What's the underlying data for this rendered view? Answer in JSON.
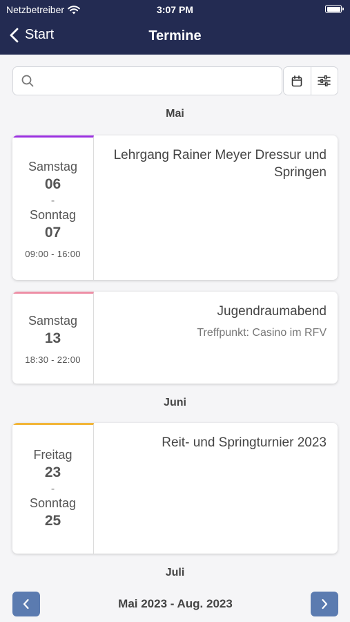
{
  "status_bar": {
    "carrier": "Netzbetreiber",
    "time": "3:07 PM"
  },
  "nav": {
    "back_label": "Start",
    "title": "Termine"
  },
  "search": {
    "placeholder": "",
    "value": ""
  },
  "toolbar": {
    "calendar_icon": "calendar-icon",
    "filter_icon": "sliders-icon"
  },
  "months": [
    "Mai",
    "Juni",
    "Juli"
  ],
  "events": [
    {
      "color": "#9b30e0",
      "start_day": "Samstag",
      "start_date": "06",
      "separator": "-",
      "end_day": "Sonntag",
      "end_date": "07",
      "time": "09:00 - 16:00",
      "title": "Lehrgang Rainer Meyer Dressur und Springen",
      "subtitle": ""
    },
    {
      "color": "#ee8fa6",
      "start_day": "Samstag",
      "start_date": "13",
      "time": "18:30 - 22:00",
      "title": "Jugendraumabend",
      "subtitle": "Treffpunkt: Casino im RFV"
    },
    {
      "color": "#f2b63a",
      "start_day": "Freitag",
      "start_date": "23",
      "separator": "-",
      "end_day": "Sonntag",
      "end_date": "25",
      "time": "",
      "title": "Reit- und Springturnier 2023",
      "subtitle": ""
    }
  ],
  "pager": {
    "range_label": "Mai 2023 - Aug. 2023",
    "prev_icon": "chevron-left-icon",
    "next_icon": "chevron-right-icon"
  },
  "colors": {
    "nav_bg": "#232b52",
    "pager_btn": "#5b7bb0",
    "background": "#f5f5f7"
  }
}
